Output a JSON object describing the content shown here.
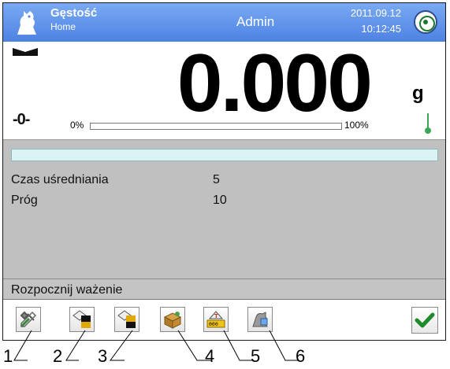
{
  "header": {
    "mode_title": "Gęstość",
    "mode_subtitle": "Home",
    "user": "Admin",
    "date": "2011.09.12",
    "time": "10:12:45",
    "logo_icon": "rat-logo-icon",
    "status_icon": "target-icon",
    "background": "#5a8ce8"
  },
  "display": {
    "weight": "0.000",
    "unit": "g",
    "zero_indicator": "-0-",
    "range_min_label": "0%",
    "range_max_label": "100%",
    "range_fill_percent": 0,
    "stability_icon": "stable-marker-icon",
    "temperature_icon": "thermometer-icon"
  },
  "info": {
    "rows": [
      {
        "label": "Czas uśredniania",
        "value": "5"
      },
      {
        "label": "Próg",
        "value": "10"
      }
    ],
    "status_message": "Rozpocznij ważenie"
  },
  "toolbar": {
    "buttons": [
      {
        "icon": "tools-icon"
      },
      {
        "icon": "printer-header-icon"
      },
      {
        "icon": "printer-footer-icon"
      },
      {
        "icon": "product-box-icon"
      },
      {
        "icon": "counter-icon"
      },
      {
        "icon": "weighing-icon"
      }
    ],
    "confirm_icon": "checkmark-icon"
  },
  "callouts": [
    "1",
    "2",
    "3",
    "4",
    "5",
    "6"
  ]
}
